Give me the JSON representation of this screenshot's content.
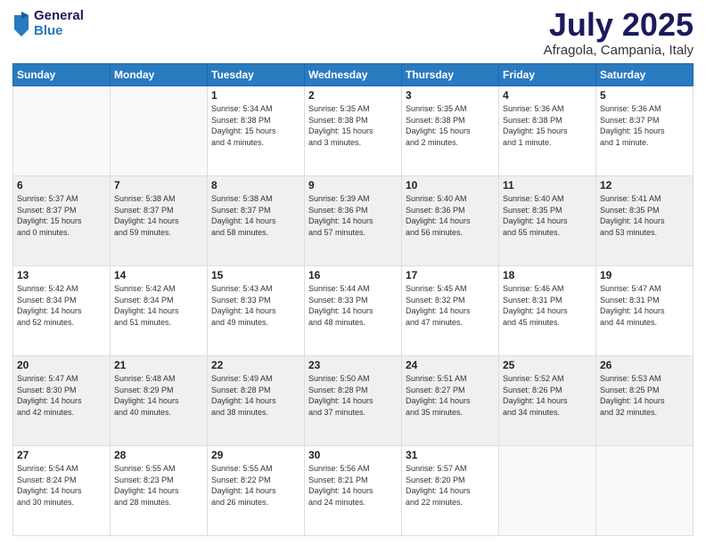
{
  "logo": {
    "general": "General",
    "blue": "Blue"
  },
  "header": {
    "month": "July 2025",
    "location": "Afragola, Campania, Italy"
  },
  "weekdays": [
    "Sunday",
    "Monday",
    "Tuesday",
    "Wednesday",
    "Thursday",
    "Friday",
    "Saturday"
  ],
  "weeks": [
    [
      {
        "day": "",
        "info": ""
      },
      {
        "day": "",
        "info": ""
      },
      {
        "day": "1",
        "info": "Sunrise: 5:34 AM\nSunset: 8:38 PM\nDaylight: 15 hours\nand 4 minutes."
      },
      {
        "day": "2",
        "info": "Sunrise: 5:35 AM\nSunset: 8:38 PM\nDaylight: 15 hours\nand 3 minutes."
      },
      {
        "day": "3",
        "info": "Sunrise: 5:35 AM\nSunset: 8:38 PM\nDaylight: 15 hours\nand 2 minutes."
      },
      {
        "day": "4",
        "info": "Sunrise: 5:36 AM\nSunset: 8:38 PM\nDaylight: 15 hours\nand 1 minute."
      },
      {
        "day": "5",
        "info": "Sunrise: 5:36 AM\nSunset: 8:37 PM\nDaylight: 15 hours\nand 1 minute."
      }
    ],
    [
      {
        "day": "6",
        "info": "Sunrise: 5:37 AM\nSunset: 8:37 PM\nDaylight: 15 hours\nand 0 minutes."
      },
      {
        "day": "7",
        "info": "Sunrise: 5:38 AM\nSunset: 8:37 PM\nDaylight: 14 hours\nand 59 minutes."
      },
      {
        "day": "8",
        "info": "Sunrise: 5:38 AM\nSunset: 8:37 PM\nDaylight: 14 hours\nand 58 minutes."
      },
      {
        "day": "9",
        "info": "Sunrise: 5:39 AM\nSunset: 8:36 PM\nDaylight: 14 hours\nand 57 minutes."
      },
      {
        "day": "10",
        "info": "Sunrise: 5:40 AM\nSunset: 8:36 PM\nDaylight: 14 hours\nand 56 minutes."
      },
      {
        "day": "11",
        "info": "Sunrise: 5:40 AM\nSunset: 8:35 PM\nDaylight: 14 hours\nand 55 minutes."
      },
      {
        "day": "12",
        "info": "Sunrise: 5:41 AM\nSunset: 8:35 PM\nDaylight: 14 hours\nand 53 minutes."
      }
    ],
    [
      {
        "day": "13",
        "info": "Sunrise: 5:42 AM\nSunset: 8:34 PM\nDaylight: 14 hours\nand 52 minutes."
      },
      {
        "day": "14",
        "info": "Sunrise: 5:42 AM\nSunset: 8:34 PM\nDaylight: 14 hours\nand 51 minutes."
      },
      {
        "day": "15",
        "info": "Sunrise: 5:43 AM\nSunset: 8:33 PM\nDaylight: 14 hours\nand 49 minutes."
      },
      {
        "day": "16",
        "info": "Sunrise: 5:44 AM\nSunset: 8:33 PM\nDaylight: 14 hours\nand 48 minutes."
      },
      {
        "day": "17",
        "info": "Sunrise: 5:45 AM\nSunset: 8:32 PM\nDaylight: 14 hours\nand 47 minutes."
      },
      {
        "day": "18",
        "info": "Sunrise: 5:46 AM\nSunset: 8:31 PM\nDaylight: 14 hours\nand 45 minutes."
      },
      {
        "day": "19",
        "info": "Sunrise: 5:47 AM\nSunset: 8:31 PM\nDaylight: 14 hours\nand 44 minutes."
      }
    ],
    [
      {
        "day": "20",
        "info": "Sunrise: 5:47 AM\nSunset: 8:30 PM\nDaylight: 14 hours\nand 42 minutes."
      },
      {
        "day": "21",
        "info": "Sunrise: 5:48 AM\nSunset: 8:29 PM\nDaylight: 14 hours\nand 40 minutes."
      },
      {
        "day": "22",
        "info": "Sunrise: 5:49 AM\nSunset: 8:28 PM\nDaylight: 14 hours\nand 38 minutes."
      },
      {
        "day": "23",
        "info": "Sunrise: 5:50 AM\nSunset: 8:28 PM\nDaylight: 14 hours\nand 37 minutes."
      },
      {
        "day": "24",
        "info": "Sunrise: 5:51 AM\nSunset: 8:27 PM\nDaylight: 14 hours\nand 35 minutes."
      },
      {
        "day": "25",
        "info": "Sunrise: 5:52 AM\nSunset: 8:26 PM\nDaylight: 14 hours\nand 34 minutes."
      },
      {
        "day": "26",
        "info": "Sunrise: 5:53 AM\nSunset: 8:25 PM\nDaylight: 14 hours\nand 32 minutes."
      }
    ],
    [
      {
        "day": "27",
        "info": "Sunrise: 5:54 AM\nSunset: 8:24 PM\nDaylight: 14 hours\nand 30 minutes."
      },
      {
        "day": "28",
        "info": "Sunrise: 5:55 AM\nSunset: 8:23 PM\nDaylight: 14 hours\nand 28 minutes."
      },
      {
        "day": "29",
        "info": "Sunrise: 5:55 AM\nSunset: 8:22 PM\nDaylight: 14 hours\nand 26 minutes."
      },
      {
        "day": "30",
        "info": "Sunrise: 5:56 AM\nSunset: 8:21 PM\nDaylight: 14 hours\nand 24 minutes."
      },
      {
        "day": "31",
        "info": "Sunrise: 5:57 AM\nSunset: 8:20 PM\nDaylight: 14 hours\nand 22 minutes."
      },
      {
        "day": "",
        "info": ""
      },
      {
        "day": "",
        "info": ""
      }
    ]
  ]
}
